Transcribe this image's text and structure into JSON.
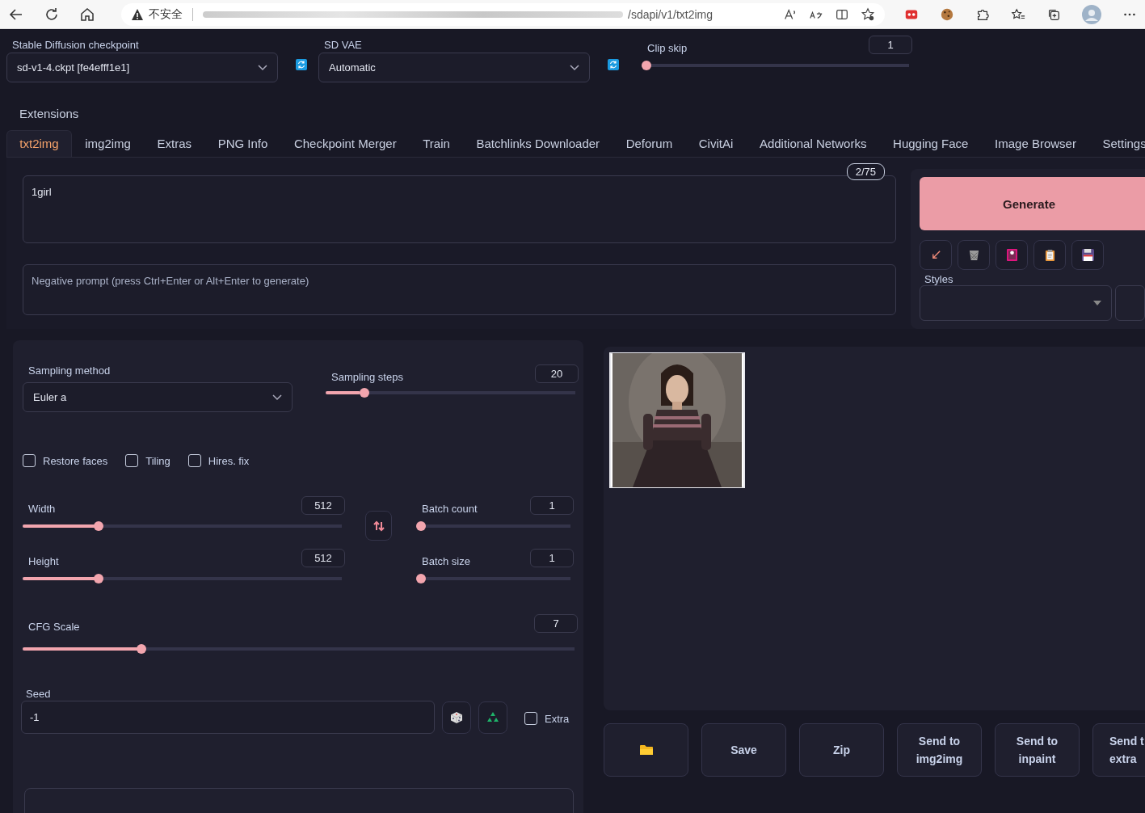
{
  "browser": {
    "security_label": "不安全",
    "url_visible": "/sdapi/v1/txt2img"
  },
  "checkpoint": {
    "label": "Stable Diffusion checkpoint",
    "value": "sd-v1-4.ckpt [fe4efff1e1]"
  },
  "vae": {
    "label": "SD VAE",
    "value": "Automatic"
  },
  "clip_skip": {
    "label": "Clip skip",
    "value": "1",
    "level": 0
  },
  "extensions_label": "Extensions",
  "tabs": [
    {
      "label": "txt2img",
      "selected": true
    },
    {
      "label": "img2img",
      "selected": false
    },
    {
      "label": "Extras",
      "selected": false
    },
    {
      "label": "PNG Info",
      "selected": false
    },
    {
      "label": "Checkpoint Merger",
      "selected": false
    },
    {
      "label": "Train",
      "selected": false
    },
    {
      "label": "Batchlinks Downloader",
      "selected": false
    },
    {
      "label": "Deforum",
      "selected": false
    },
    {
      "label": "CivitAi",
      "selected": false
    },
    {
      "label": "Additional Networks",
      "selected": false
    },
    {
      "label": "Hugging Face",
      "selected": false
    },
    {
      "label": "Image Browser",
      "selected": false
    },
    {
      "label": "Settings",
      "selected": false
    }
  ],
  "prompt": {
    "value": "1girl",
    "token_count": "2/75"
  },
  "negative_prompt": {
    "placeholder": "Negative prompt (press Ctrl+Enter or Alt+Enter to generate)"
  },
  "generate_button": "Generate",
  "styles": {
    "label": "Styles"
  },
  "sampling_method": {
    "label": "Sampling method",
    "value": "Euler a"
  },
  "sampling_steps": {
    "label": "Sampling steps",
    "value": "20",
    "level": 0.14
  },
  "options": [
    {
      "label": "Restore faces",
      "checked": false
    },
    {
      "label": "Tiling",
      "checked": false
    },
    {
      "label": "Hires. fix",
      "checked": false
    }
  ],
  "width": {
    "label": "Width",
    "value": "512",
    "level": 0.23
  },
  "height": {
    "label": "Height",
    "value": "512",
    "level": 0.23
  },
  "batch_count": {
    "label": "Batch count",
    "value": "1",
    "level": 0
  },
  "batch_size": {
    "label": "Batch size",
    "value": "1",
    "level": 0
  },
  "cfg_scale": {
    "label": "CFG Scale",
    "value": "7",
    "level": 0.21
  },
  "seed": {
    "label": "Seed",
    "value": "-1"
  },
  "extra": {
    "label": "Extra",
    "checked": false
  },
  "output_buttons": [
    {
      "kind": "folder"
    },
    {
      "kind": "text",
      "lines": [
        "Save"
      ]
    },
    {
      "kind": "text",
      "lines": [
        "Zip"
      ]
    },
    {
      "kind": "text",
      "lines": [
        "Send to",
        "img2img"
      ]
    },
    {
      "kind": "text",
      "lines": [
        "Send to",
        "inpaint"
      ]
    },
    {
      "kind": "text",
      "lines": [
        "Send t",
        "extra"
      ]
    }
  ]
}
